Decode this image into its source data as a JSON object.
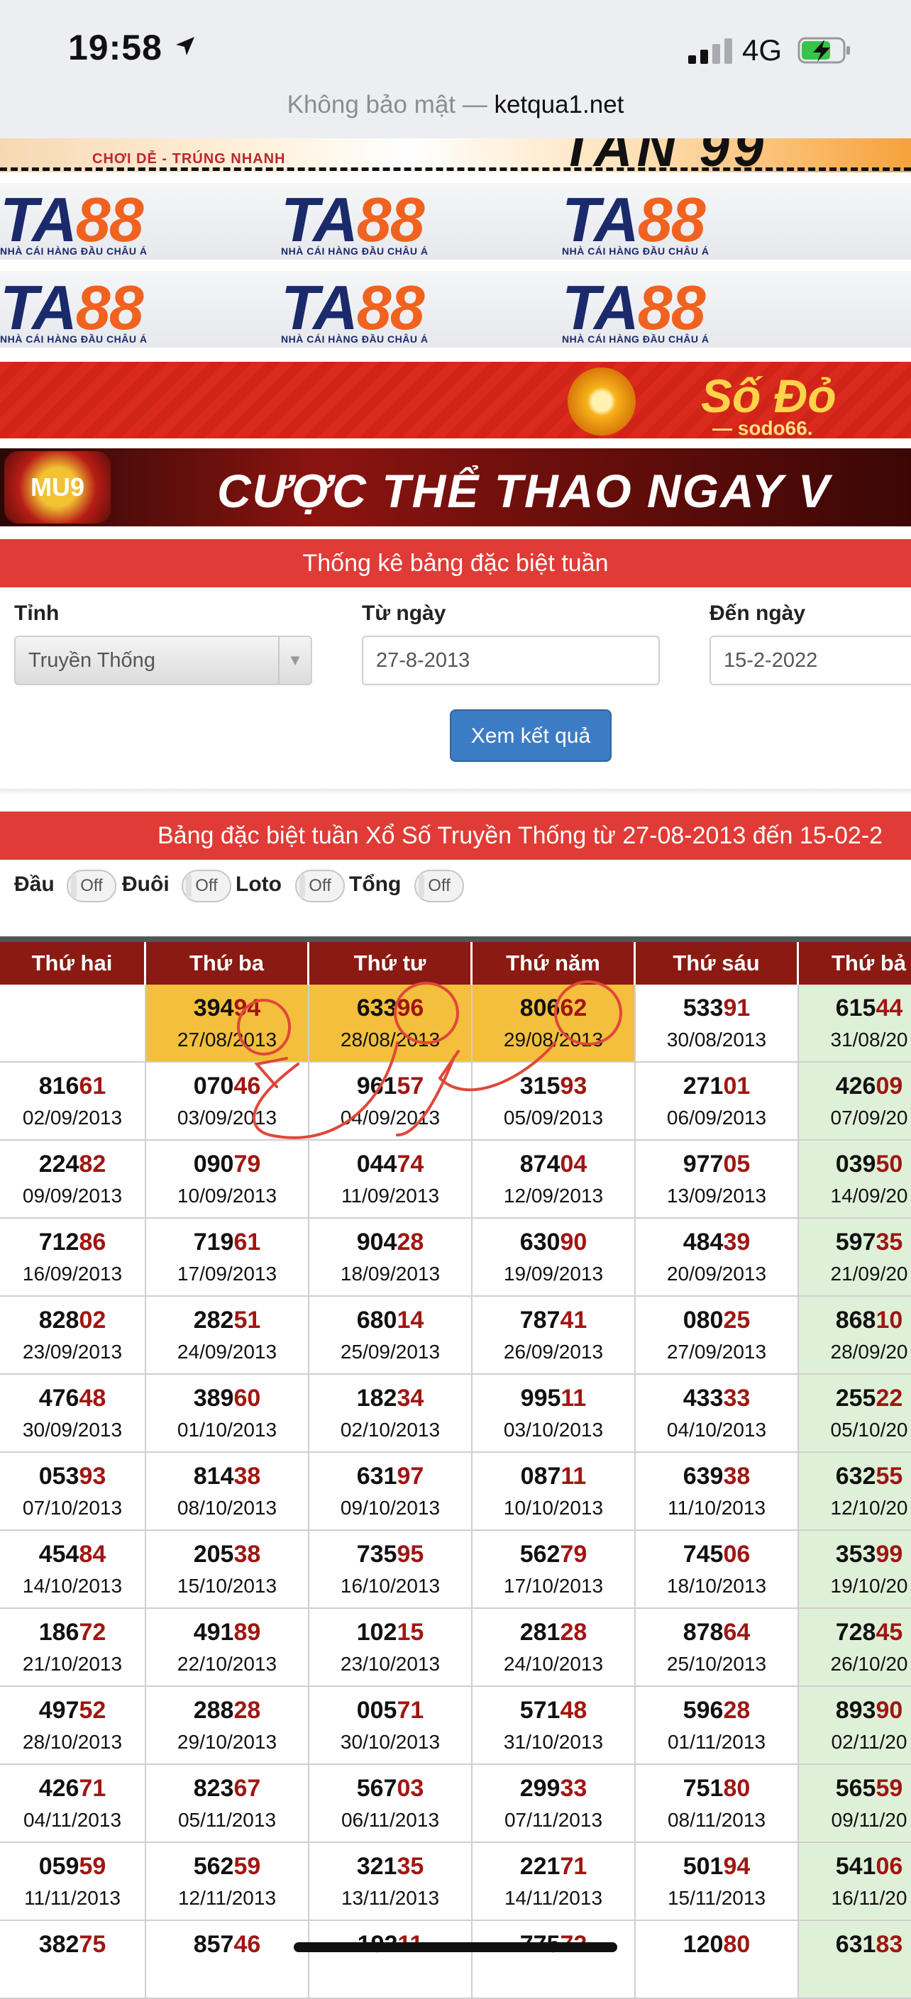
{
  "status": {
    "time": "19:58",
    "network": "4G"
  },
  "address": {
    "prefix": "Không bảo mật — ",
    "domain": "ketqua1.net"
  },
  "banners": {
    "top_slogan": "CHƠI DỄ - TRÚNG NHANH",
    "top_big": "TAN 99",
    "ta88_mark_a": "TA",
    "ta88_mark_b": "88",
    "ta88_sub": "NHÀ CÁI HÀNG ĐẦU CHÂU Á",
    "sodo_text": "Số Đỏ",
    "sodo_sub": "— sodo66.",
    "mu9_badge": "MU9",
    "mu9_text": "CƯỢC THỂ THAO NGAY V"
  },
  "form": {
    "title": "Thống kê bảng đặc biệt tuần",
    "province_label": "Tỉnh",
    "province_value": "Truyền Thống",
    "from_label": "Từ ngày",
    "from_value": "27-8-2013",
    "to_label": "Đến ngày",
    "to_value": "15-2-2022",
    "submit": "Xem kết quả"
  },
  "result_title": "Bảng đặc biệt tuần Xổ Số Truyền Thống từ 27-08-2013 đến 15-02-2",
  "toggles": [
    {
      "label": "Đầu",
      "state": "Off"
    },
    {
      "label": "Đuôi",
      "state": "Off"
    },
    {
      "label": "Loto",
      "state": "Off"
    },
    {
      "label": "Tổng",
      "state": "Off"
    }
  ],
  "table": {
    "headers": [
      "Thứ hai",
      "Thứ ba",
      "Thứ tư",
      "Thứ năm",
      "Thứ sáu",
      "Thứ bả"
    ],
    "rows": [
      [
        null,
        {
          "h": "394",
          "t": "94",
          "d": "27/08/2013",
          "hl": true
        },
        {
          "h": "633",
          "t": "96",
          "d": "28/08/2013",
          "hl": true
        },
        {
          "h": "806",
          "t": "62",
          "d": "29/08/2013",
          "hl": true
        },
        {
          "h": "533",
          "t": "91",
          "d": "30/08/2013"
        },
        {
          "h": "615",
          "t": "44",
          "d": "31/08/20"
        }
      ],
      [
        {
          "h": "816",
          "t": "61",
          "d": "02/09/2013"
        },
        {
          "h": "070",
          "t": "46",
          "d": "03/09/2013"
        },
        {
          "h": "961",
          "t": "57",
          "d": "04/09/2013"
        },
        {
          "h": "315",
          "t": "93",
          "d": "05/09/2013"
        },
        {
          "h": "271",
          "t": "01",
          "d": "06/09/2013"
        },
        {
          "h": "426",
          "t": "09",
          "d": "07/09/20"
        }
      ],
      [
        {
          "h": "224",
          "t": "82",
          "d": "09/09/2013"
        },
        {
          "h": "090",
          "t": "79",
          "d": "10/09/2013"
        },
        {
          "h": "044",
          "t": "74",
          "d": "11/09/2013"
        },
        {
          "h": "874",
          "t": "04",
          "d": "12/09/2013"
        },
        {
          "h": "977",
          "t": "05",
          "d": "13/09/2013"
        },
        {
          "h": "039",
          "t": "50",
          "d": "14/09/20"
        }
      ],
      [
        {
          "h": "712",
          "t": "86",
          "d": "16/09/2013"
        },
        {
          "h": "719",
          "t": "61",
          "d": "17/09/2013"
        },
        {
          "h": "904",
          "t": "28",
          "d": "18/09/2013"
        },
        {
          "h": "630",
          "t": "90",
          "d": "19/09/2013"
        },
        {
          "h": "484",
          "t": "39",
          "d": "20/09/2013"
        },
        {
          "h": "597",
          "t": "35",
          "d": "21/09/20"
        }
      ],
      [
        {
          "h": "828",
          "t": "02",
          "d": "23/09/2013"
        },
        {
          "h": "282",
          "t": "51",
          "d": "24/09/2013"
        },
        {
          "h": "680",
          "t": "14",
          "d": "25/09/2013"
        },
        {
          "h": "787",
          "t": "41",
          "d": "26/09/2013"
        },
        {
          "h": "080",
          "t": "25",
          "d": "27/09/2013"
        },
        {
          "h": "868",
          "t": "10",
          "d": "28/09/20"
        }
      ],
      [
        {
          "h": "476",
          "t": "48",
          "d": "30/09/2013"
        },
        {
          "h": "389",
          "t": "60",
          "d": "01/10/2013"
        },
        {
          "h": "182",
          "t": "34",
          "d": "02/10/2013"
        },
        {
          "h": "995",
          "t": "11",
          "d": "03/10/2013"
        },
        {
          "h": "433",
          "t": "33",
          "d": "04/10/2013"
        },
        {
          "h": "255",
          "t": "22",
          "d": "05/10/20"
        }
      ],
      [
        {
          "h": "053",
          "t": "93",
          "d": "07/10/2013"
        },
        {
          "h": "814",
          "t": "38",
          "d": "08/10/2013"
        },
        {
          "h": "631",
          "t": "97",
          "d": "09/10/2013"
        },
        {
          "h": "087",
          "t": "11",
          "d": "10/10/2013"
        },
        {
          "h": "639",
          "t": "38",
          "d": "11/10/2013"
        },
        {
          "h": "632",
          "t": "55",
          "d": "12/10/20"
        }
      ],
      [
        {
          "h": "454",
          "t": "84",
          "d": "14/10/2013"
        },
        {
          "h": "205",
          "t": "38",
          "d": "15/10/2013"
        },
        {
          "h": "735",
          "t": "95",
          "d": "16/10/2013"
        },
        {
          "h": "562",
          "t": "79",
          "d": "17/10/2013"
        },
        {
          "h": "745",
          "t": "06",
          "d": "18/10/2013"
        },
        {
          "h": "353",
          "t": "99",
          "d": "19/10/20"
        }
      ],
      [
        {
          "h": "186",
          "t": "72",
          "d": "21/10/2013"
        },
        {
          "h": "491",
          "t": "89",
          "d": "22/10/2013"
        },
        {
          "h": "102",
          "t": "15",
          "d": "23/10/2013"
        },
        {
          "h": "281",
          "t": "28",
          "d": "24/10/2013"
        },
        {
          "h": "878",
          "t": "64",
          "d": "25/10/2013"
        },
        {
          "h": "728",
          "t": "45",
          "d": "26/10/20"
        }
      ],
      [
        {
          "h": "497",
          "t": "52",
          "d": "28/10/2013"
        },
        {
          "h": "288",
          "t": "28",
          "d": "29/10/2013"
        },
        {
          "h": "005",
          "t": "71",
          "d": "30/10/2013"
        },
        {
          "h": "571",
          "t": "48",
          "d": "31/10/2013"
        },
        {
          "h": "596",
          "t": "28",
          "d": "01/11/2013"
        },
        {
          "h": "893",
          "t": "90",
          "d": "02/11/20"
        }
      ],
      [
        {
          "h": "426",
          "t": "71",
          "d": "04/11/2013"
        },
        {
          "h": "823",
          "t": "67",
          "d": "05/11/2013"
        },
        {
          "h": "567",
          "t": "03",
          "d": "06/11/2013"
        },
        {
          "h": "299",
          "t": "33",
          "d": "07/11/2013"
        },
        {
          "h": "751",
          "t": "80",
          "d": "08/11/2013"
        },
        {
          "h": "565",
          "t": "59",
          "d": "09/11/20"
        }
      ],
      [
        {
          "h": "059",
          "t": "59",
          "d": "11/11/2013"
        },
        {
          "h": "562",
          "t": "59",
          "d": "12/11/2013"
        },
        {
          "h": "321",
          "t": "35",
          "d": "13/11/2013"
        },
        {
          "h": "221",
          "t": "71",
          "d": "14/11/2013"
        },
        {
          "h": "501",
          "t": "94",
          "d": "15/11/2013"
        },
        {
          "h": "541",
          "t": "06",
          "d": "16/11/20"
        }
      ],
      [
        {
          "h": "382",
          "t": "75",
          "d": ""
        },
        {
          "h": "857",
          "t": "46",
          "d": ""
        },
        {
          "h": "192",
          "t": "11",
          "d": ""
        },
        {
          "h": "775",
          "t": "72",
          "d": ""
        },
        {
          "h": "120",
          "t": "80",
          "d": ""
        },
        {
          "h": "631",
          "t": "83",
          "d": ""
        }
      ]
    ]
  },
  "colors": {
    "accent_red": "#e03b36",
    "header_red": "#8a1a12",
    "highlight": "#f3bf3c",
    "saturday": "#dff0d8",
    "tail_red": "#a01612",
    "button_blue": "#3c7cc4"
  }
}
